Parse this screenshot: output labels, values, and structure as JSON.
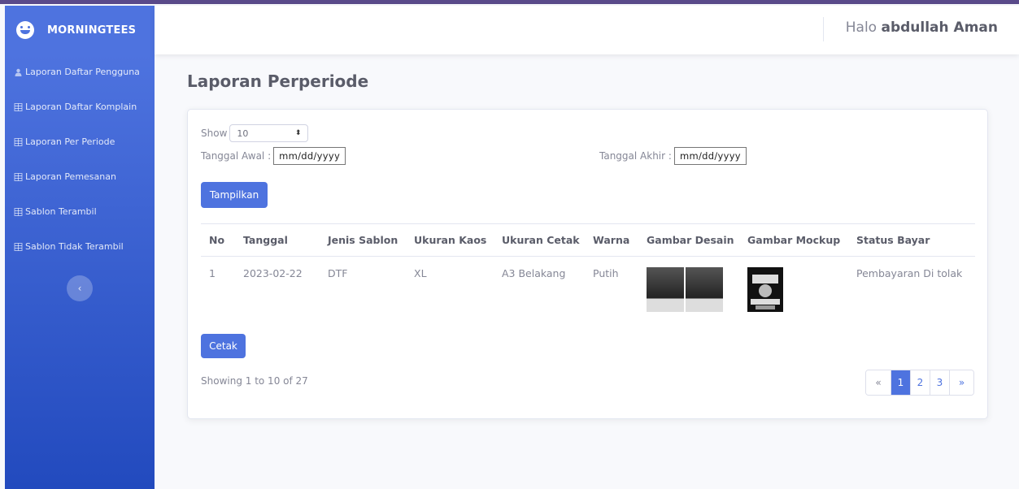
{
  "brand": {
    "name": "MORNINGTEES"
  },
  "sidebar": {
    "items": [
      {
        "label": "Laporan Daftar Pengguna",
        "icon": "user-icon"
      },
      {
        "label": "Laporan Daftar Komplain",
        "icon": "table-icon"
      },
      {
        "label": "Laporan Per Periode",
        "icon": "table-icon"
      },
      {
        "label": "Laporan Pemesanan",
        "icon": "table-icon"
      },
      {
        "label": "Sablon Terambil",
        "icon": "table-icon"
      },
      {
        "label": "Sablon Tidak Terambil",
        "icon": "table-icon"
      }
    ],
    "toggle_icon": "‹"
  },
  "topbar": {
    "greeting": "Halo",
    "user_name": "abdullah Aman"
  },
  "page": {
    "title": "Laporan Perperiode"
  },
  "filters": {
    "show_label": "Show",
    "show_value": "10",
    "start_label": "Tanggal Awal :",
    "start_value": "mm/dd/yyyy",
    "end_label": "Tanggal Akhir :",
    "end_value": "mm/dd/yyyy",
    "submit_label": "Tampilkan"
  },
  "table": {
    "headers": [
      "No",
      "Tanggal",
      "Jenis Sablon",
      "Ukuran Kaos",
      "Ukuran Cetak",
      "Warna",
      "Gambar Desain",
      "Gambar Mockup",
      "Status Bayar"
    ],
    "rows": [
      {
        "no": "1",
        "tanggal": "2023-02-22",
        "jenis": "DTF",
        "ukuran_kaos": "XL",
        "ukuran_cetak": "A3 Belakang",
        "warna": "Putih",
        "status": "Pembayaran Di tolak"
      }
    ]
  },
  "actions": {
    "print_label": "Cetak"
  },
  "footer": {
    "showing": "Showing 1 to 10 of 27"
  },
  "pagination": {
    "prev": "«",
    "pages": [
      "1",
      "2",
      "3"
    ],
    "next": "»",
    "active": "1"
  },
  "colors": {
    "primary": "#4e73df",
    "sidebar_end": "#224abe"
  }
}
